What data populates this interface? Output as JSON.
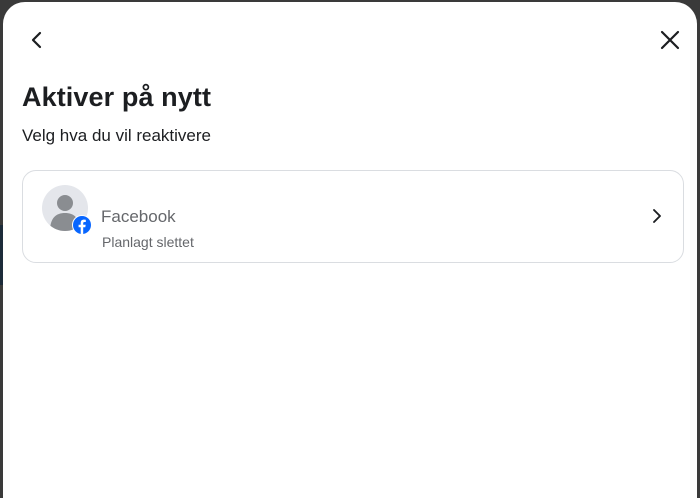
{
  "dialog": {
    "title": "Aktiver på nytt",
    "subtitle": "Velg hva du vil reaktivere"
  },
  "header": {
    "back_icon": "chevron-left-icon",
    "close_icon": "close-icon"
  },
  "accounts": [
    {
      "name": "Facebook",
      "status": "Planlagt slettet",
      "avatar_icon": "default-avatar-icon",
      "badge_icon": "facebook-icon",
      "badge_color": "#0866ff"
    }
  ],
  "colors": {
    "title_text": "#1c1e21",
    "secondary_text": "#65676b",
    "card_border": "#dadde1"
  }
}
